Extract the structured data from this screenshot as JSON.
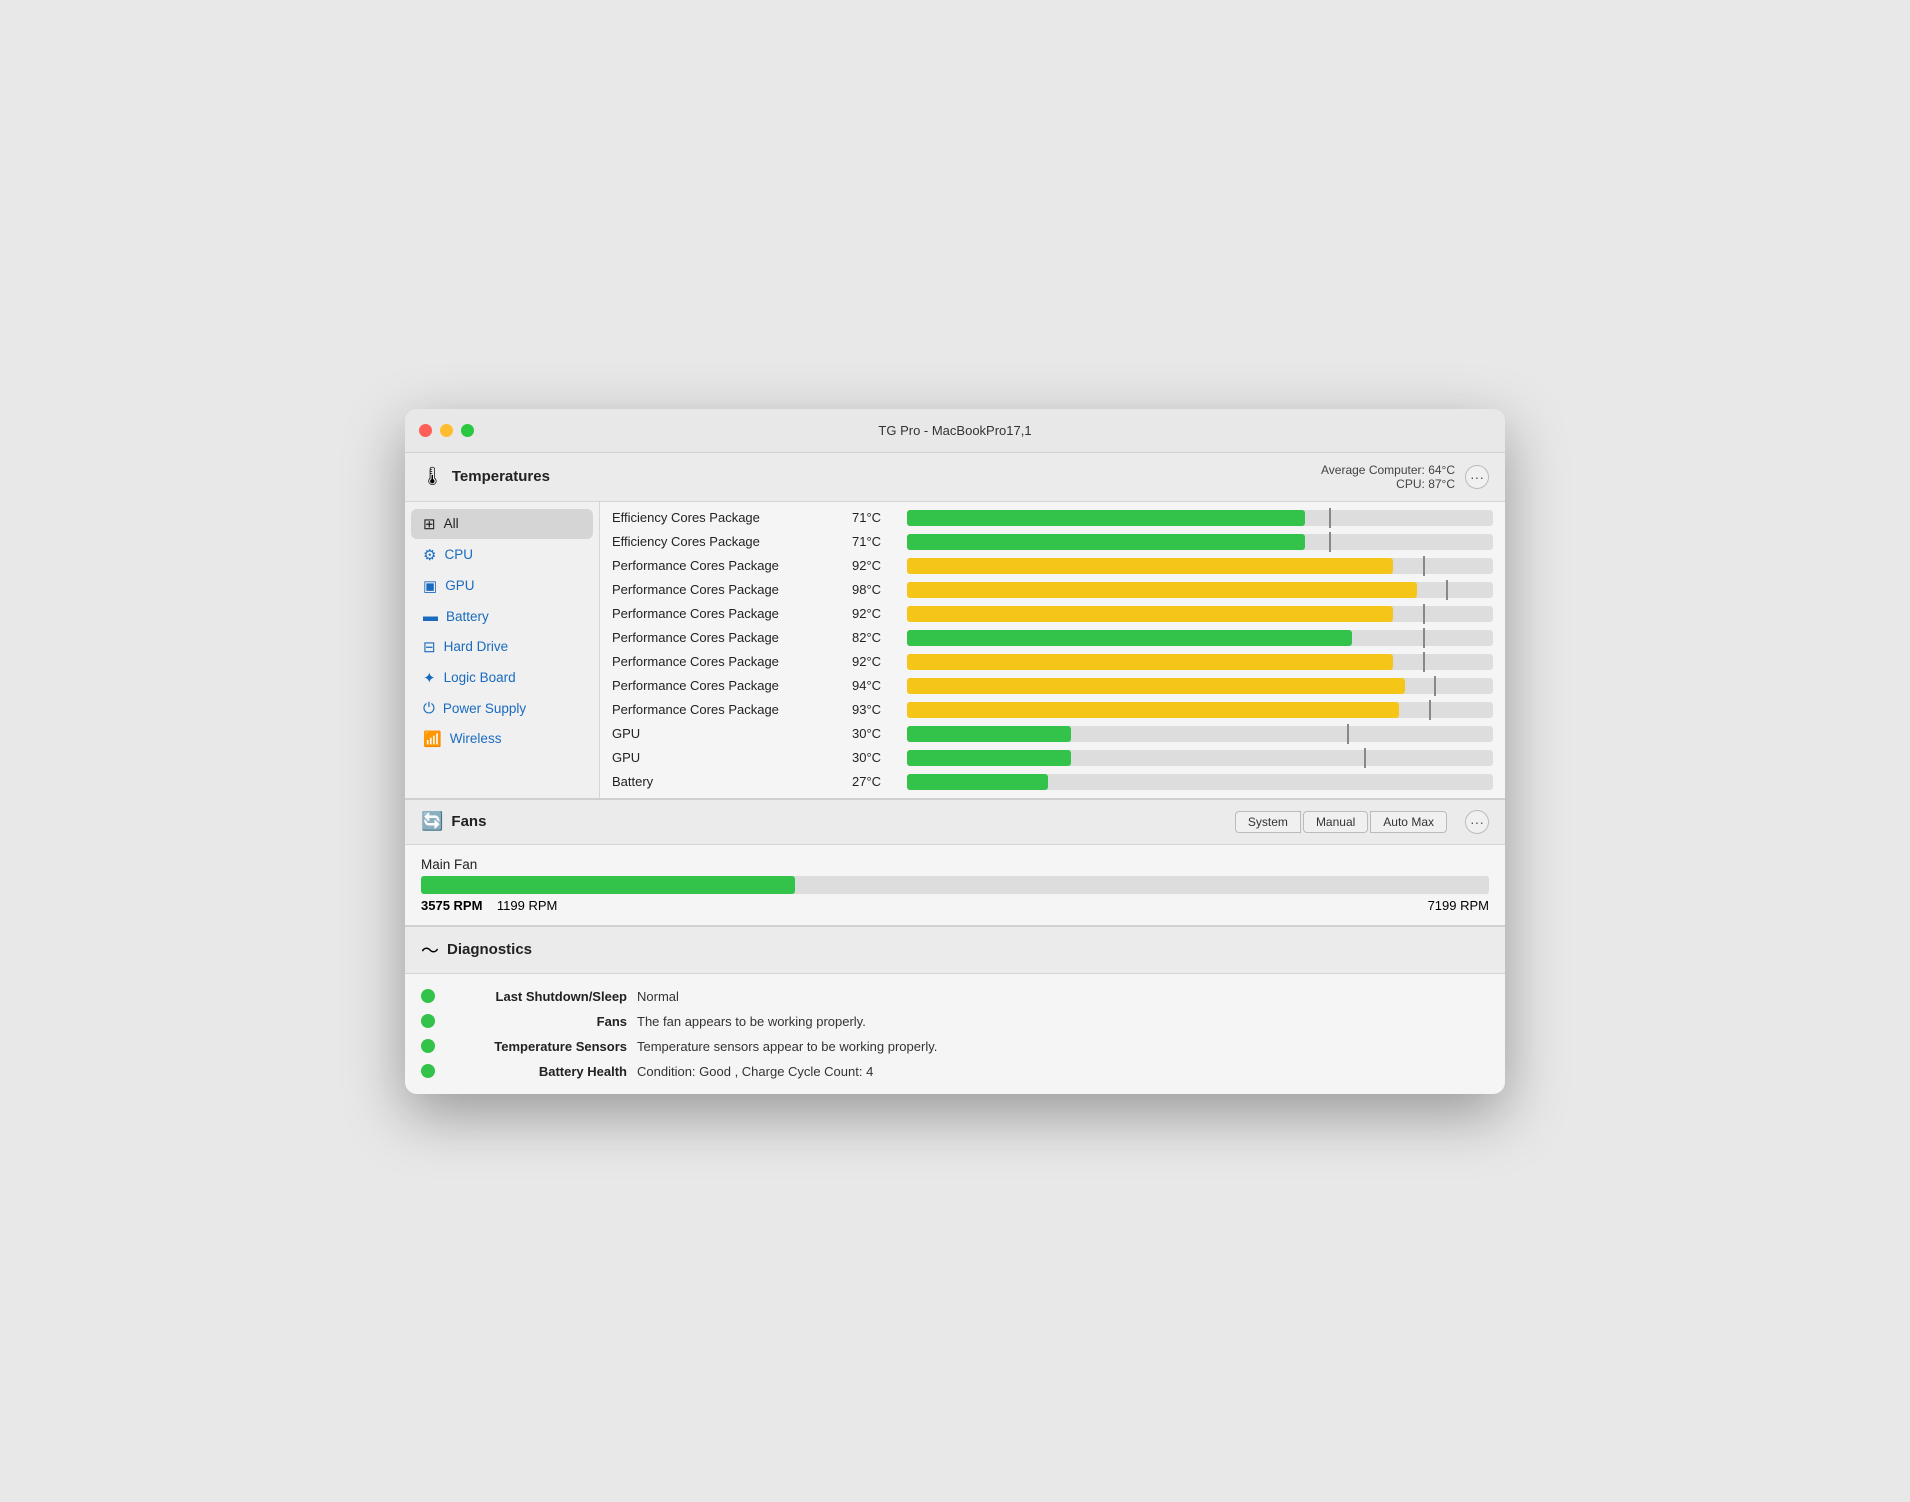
{
  "window": {
    "title": "TG Pro - MacBookPro17,1"
  },
  "temperatures": {
    "section_title": "Temperatures",
    "avg_computer_label": "Average Computer:",
    "avg_computer_value": "64°C",
    "cpu_label": "CPU:",
    "cpu_value": "87°C",
    "sidebar": {
      "items": [
        {
          "id": "all",
          "label": "All",
          "icon": "⊞",
          "active": true
        },
        {
          "id": "cpu",
          "label": "CPU",
          "icon": "⚙",
          "active": false
        },
        {
          "id": "gpu",
          "label": "GPU",
          "icon": "▣",
          "active": false
        },
        {
          "id": "battery",
          "label": "Battery",
          "icon": "▬",
          "active": false
        },
        {
          "id": "harddrive",
          "label": "Hard Drive",
          "icon": "⊟",
          "active": false
        },
        {
          "id": "logicboard",
          "label": "Logic Board",
          "icon": "✦",
          "active": false
        },
        {
          "id": "powersupply",
          "label": "Power Supply",
          "icon": "⏻",
          "active": false
        },
        {
          "id": "wireless",
          "label": "Wireless",
          "icon": "📶",
          "active": false
        }
      ]
    },
    "rows": [
      {
        "label": "Efficiency Cores Package",
        "value": "71°C",
        "fill_pct": 68,
        "marker_pct": 72,
        "color": "green"
      },
      {
        "label": "Efficiency Cores Package",
        "value": "71°C",
        "fill_pct": 68,
        "marker_pct": 72,
        "color": "green"
      },
      {
        "label": "Performance Cores Package",
        "value": "92°C",
        "fill_pct": 83,
        "marker_pct": 88,
        "color": "yellow"
      },
      {
        "label": "Performance Cores Package",
        "value": "98°C",
        "fill_pct": 87,
        "marker_pct": 92,
        "color": "yellow"
      },
      {
        "label": "Performance Cores Package",
        "value": "92°C",
        "fill_pct": 83,
        "marker_pct": 88,
        "color": "yellow"
      },
      {
        "label": "Performance Cores Package",
        "value": "82°C",
        "fill_pct": 76,
        "marker_pct": 88,
        "color": "green"
      },
      {
        "label": "Performance Cores Package",
        "value": "92°C",
        "fill_pct": 83,
        "marker_pct": 88,
        "color": "yellow"
      },
      {
        "label": "Performance Cores Package",
        "value": "94°C",
        "fill_pct": 85,
        "marker_pct": 90,
        "color": "yellow"
      },
      {
        "label": "Performance Cores Package",
        "value": "93°C",
        "fill_pct": 84,
        "marker_pct": 89,
        "color": "yellow"
      },
      {
        "label": "GPU",
        "value": "30°C",
        "fill_pct": 28,
        "marker_pct": 75,
        "color": "green"
      },
      {
        "label": "GPU",
        "value": "30°C",
        "fill_pct": 28,
        "marker_pct": 78,
        "color": "green"
      },
      {
        "label": "Battery",
        "value": "27°C",
        "fill_pct": 24,
        "marker_pct": 0,
        "color": "green"
      }
    ]
  },
  "fans": {
    "section_title": "Fans",
    "btn_system": "System",
    "btn_manual": "Manual",
    "btn_automax": "Auto Max",
    "main_fan_label": "Main Fan",
    "current_rpm": "3575 RPM",
    "min_rpm": "1199 RPM",
    "max_rpm": "7199 RPM",
    "fill_pct": 35
  },
  "diagnostics": {
    "section_title": "Diagnostics",
    "rows": [
      {
        "key": "Last Shutdown/Sleep",
        "value": "Normal"
      },
      {
        "key": "Fans",
        "value": "The fan appears to be working properly."
      },
      {
        "key": "Temperature Sensors",
        "value": "Temperature sensors appear to be working properly."
      },
      {
        "key": "Battery Health",
        "value": "Condition: Good , Charge Cycle Count: 4"
      }
    ]
  }
}
